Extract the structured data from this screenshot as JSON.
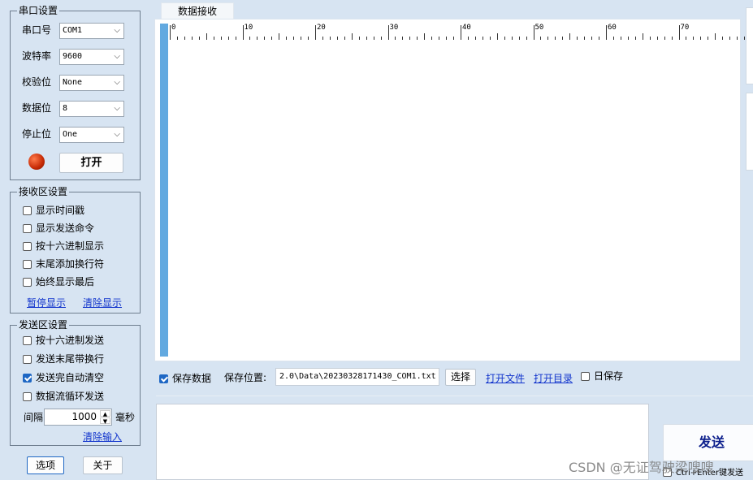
{
  "port_settings": {
    "title": "串口设置",
    "rows": [
      {
        "label": "串口号",
        "value": "COM1"
      },
      {
        "label": "波特率",
        "value": "9600"
      },
      {
        "label": "校验位",
        "value": "None"
      },
      {
        "label": "数据位",
        "value": "8"
      },
      {
        "label": "停止位",
        "value": "One"
      }
    ],
    "status_color": "#c62a05",
    "open_button": "打开"
  },
  "receive_settings": {
    "title": "接收区设置",
    "options": [
      {
        "label": "显示时间戳",
        "checked": false
      },
      {
        "label": "显示发送命令",
        "checked": false
      },
      {
        "label": "按十六进制显示",
        "checked": false
      },
      {
        "label": "末尾添加换行符",
        "checked": false
      },
      {
        "label": "始终显示最后",
        "checked": false
      }
    ],
    "pause_link": "暂停显示",
    "clear_link": "清除显示"
  },
  "send_settings": {
    "title": "发送区设置",
    "options": [
      {
        "label": "按十六进制发送",
        "checked": false
      },
      {
        "label": "发送末尾带换行",
        "checked": false
      },
      {
        "label": "发送完自动清空",
        "checked": true
      },
      {
        "label": "数据流循环发送",
        "checked": false
      }
    ],
    "interval_label": "间隔",
    "interval_value": "1000",
    "interval_unit": "毫秒",
    "clear_input_link": "清除输入"
  },
  "footer_buttons": {
    "options": "选项",
    "close": "关于"
  },
  "receive_panel": {
    "tab_label": "数据接收",
    "ruler_labels": [
      "0",
      "10",
      "20",
      "30",
      "40",
      "50",
      "60",
      "70"
    ]
  },
  "save_bar": {
    "save_data_label": "保存数据",
    "save_data_checked": true,
    "location_label": "保存位置:",
    "path_value": "2.0\\Data\\20230328171430_COM1.txt",
    "choose_button": "选择",
    "open_file_link": "打开文件",
    "open_dir_link": "打开目录",
    "daily_save_label": "日保存",
    "daily_save_checked": false
  },
  "send_panel": {
    "send_button": "发送",
    "ctrl_enter_label": "Ctrl+Enter键发送"
  },
  "watermark": "CSDN @无证驾驶梁嗖嗖",
  "colors": {
    "accent": "#1e67c4",
    "link": "#1134cc",
    "send_text": "#0d1f8c",
    "receive_sidebar": "#62a9e0"
  }
}
